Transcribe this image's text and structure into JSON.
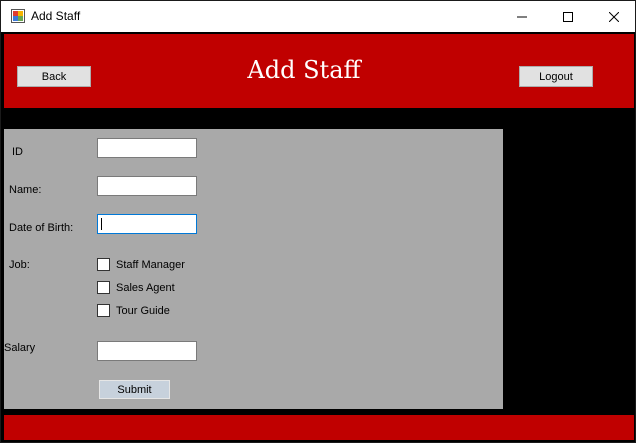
{
  "window": {
    "title": "Add Staff",
    "icon": "app-form-icon"
  },
  "header": {
    "title": "Add Staff",
    "back_label": "Back",
    "logout_label": "Logout"
  },
  "form": {
    "id_label": "ID",
    "name_label": "Name:",
    "dob_label": "Date of Birth:",
    "job_label": "Job:",
    "salary_label": "Salary",
    "id_value": "",
    "name_value": "",
    "dob_value": "",
    "salary_value": "",
    "jobs": [
      {
        "label": "Staff Manager",
        "checked": false
      },
      {
        "label": "Sales Agent",
        "checked": false
      },
      {
        "label": "Tour Guide",
        "checked": false
      }
    ],
    "submit_label": "Submit"
  },
  "colors": {
    "header": "#c00000",
    "panel": "#a9a9a9",
    "background": "#000000"
  }
}
